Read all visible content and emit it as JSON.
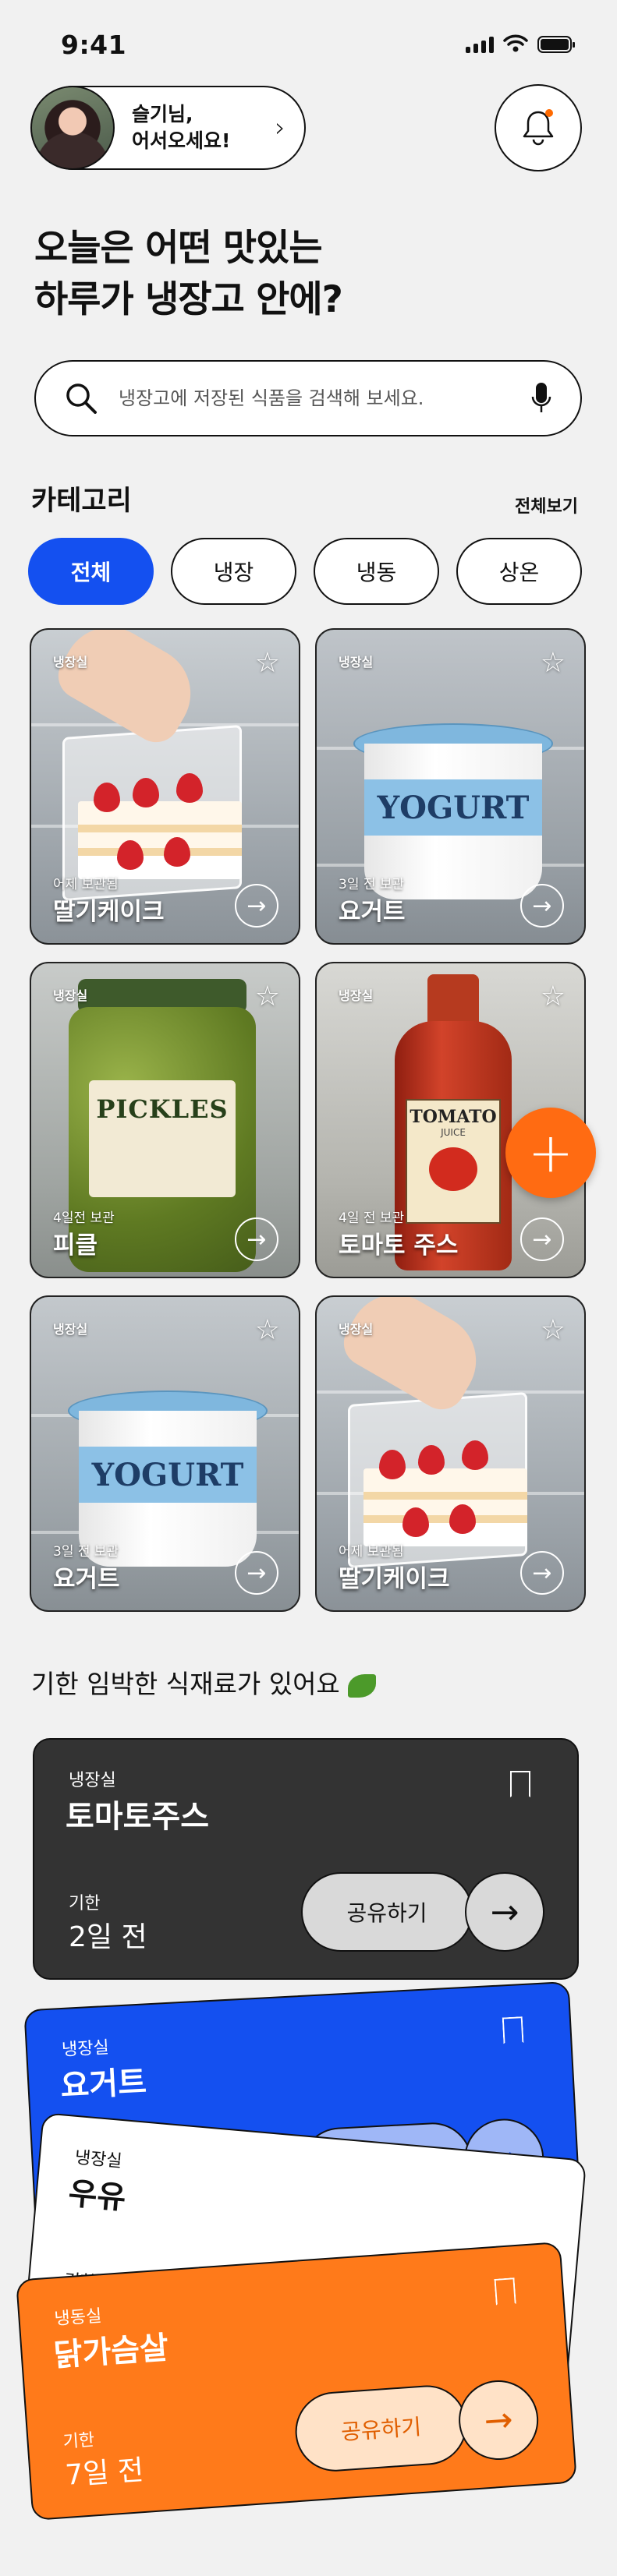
{
  "status": {
    "time": "9:41"
  },
  "greeting": {
    "line1": "슬기님,",
    "line2": "어서오세요!"
  },
  "headline": {
    "line1": "오늘은 어떤 맛있는",
    "line2": "하루가 냉장고 안에?"
  },
  "search": {
    "placeholder": "냉장고에 저장된 식품을 검색해 보세요."
  },
  "category": {
    "title": "카테고리",
    "see_all": "전체보기",
    "chips": [
      "전체",
      "냉장",
      "냉동",
      "상온"
    ],
    "active_index": 0
  },
  "foods": [
    {
      "location": "냉장실",
      "kept": "어제 보관됨",
      "name": "딸기케이크",
      "illustration": "strawberry-cake"
    },
    {
      "location": "냉장실",
      "kept": "3일 전 보관",
      "name": "요거트",
      "illustration": "yogurt",
      "label": "YOGURT"
    },
    {
      "location": "냉장실",
      "kept": "4일전 보관",
      "name": "피클",
      "illustration": "pickles",
      "label": "PICKLES"
    },
    {
      "location": "냉장실",
      "kept": "4일 전 보관",
      "name": "토마토 주스",
      "illustration": "tomato-juice",
      "label": "TOMATO",
      "sublabel": "JUICE"
    },
    {
      "location": "냉장실",
      "kept": "3일 전 보관",
      "name": "요거트",
      "illustration": "yogurt",
      "label": "YOGURT"
    },
    {
      "location": "냉장실",
      "kept": "어제 보관됨",
      "name": "딸기케이크",
      "illustration": "strawberry-cake"
    }
  ],
  "fab": {
    "label": "+"
  },
  "expiring": {
    "title": "기한 임박한 식재료가 있어요",
    "deadline_label": "기한",
    "share_label": "공유하기",
    "cards": [
      {
        "location": "냉장실",
        "name": "토마토주스",
        "deadline": "2일 전",
        "bg": "#333333",
        "fg": "#ffffff"
      },
      {
        "location": "냉장실",
        "name": "요거트",
        "deadline": "",
        "bg": "#1450f0",
        "fg": "#ffffff"
      },
      {
        "location": "냉장실",
        "name": "우유",
        "deadline": "",
        "bg": "#ffffff",
        "fg": "#111111"
      },
      {
        "location": "냉동실",
        "name": "닭가슴살",
        "deadline": "7일 전",
        "bg": "#ff7a1a",
        "fg": "#ffffff"
      }
    ]
  },
  "colors": {
    "primary": "#1450f0",
    "accent": "#ff6b12",
    "background": "#f1f1f1"
  }
}
